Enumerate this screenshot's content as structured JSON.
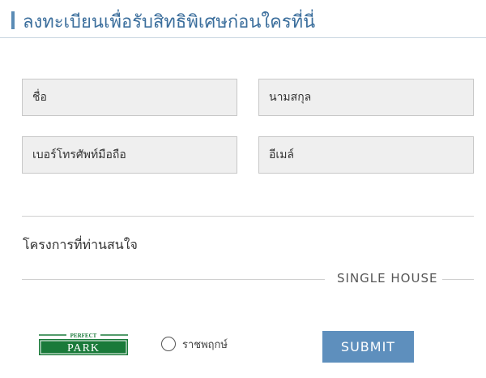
{
  "header": {
    "title": "ลงทะเบียนเพื่อรับสิทธิพิเศษก่อนใครที่นี่"
  },
  "form": {
    "first_name": {
      "placeholder": "ชื่อ",
      "value": ""
    },
    "last_name": {
      "placeholder": "นามสกุล",
      "value": ""
    },
    "phone": {
      "placeholder": "เบอร์โทรศัพท์มือถือ",
      "value": ""
    },
    "email": {
      "placeholder": "อีเมล์",
      "value": ""
    }
  },
  "projects": {
    "label": "โครงการที่ท่านสนใจ",
    "group_label": "SINGLE HOUSE",
    "logo": {
      "top_text": "PERFECT",
      "main_text": "PARK",
      "color": "#1a7a3a"
    },
    "option": {
      "label": "ราชพฤกษ์",
      "checked": false
    }
  },
  "submit_label": "SUBMIT",
  "colors": {
    "accent": "#5e8fbd",
    "title": "#3b6e9c",
    "field_bg": "#efefef",
    "logo_green": "#1a7a3a"
  }
}
